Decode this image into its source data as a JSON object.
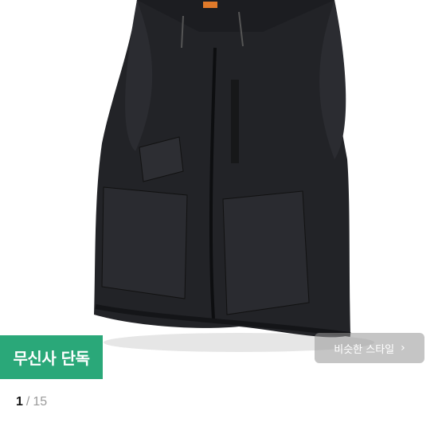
{
  "gallery": {
    "product_image": "black-utility-vest",
    "exclusive_badge": "무신사 단독",
    "similar_style_button": "비슷한 스타일",
    "chevron_icon": "chevron-right-icon",
    "badge_color": "#2aa879"
  },
  "pager": {
    "current": "1",
    "separator": "/",
    "total": "15"
  }
}
